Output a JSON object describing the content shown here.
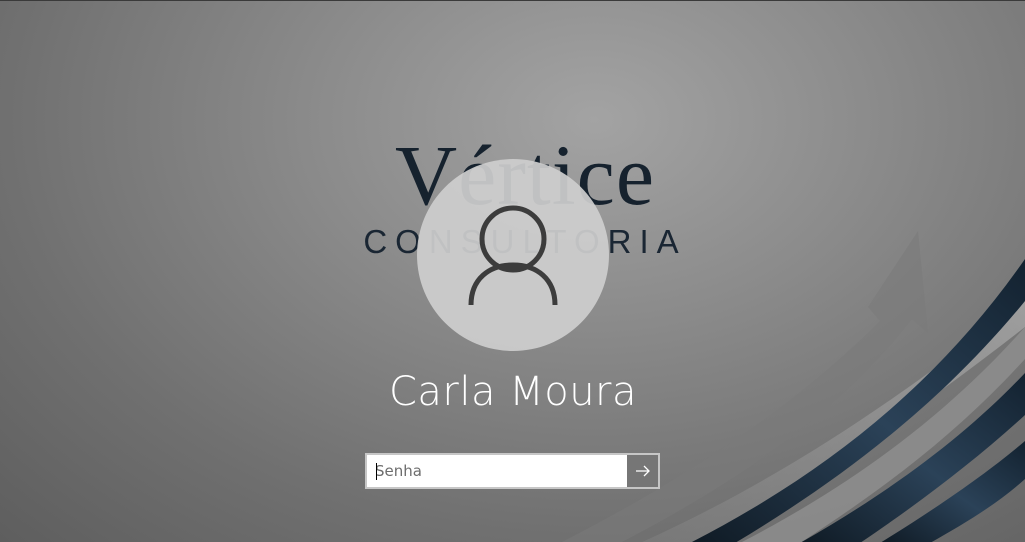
{
  "wallpaper": {
    "logo_word": "Vértice",
    "logo_sub": "CONSULTORIA",
    "accent_color": "#1f3245"
  },
  "login": {
    "avatar_icon": "user-icon",
    "user_name": "Carla Moura",
    "password_placeholder": "Senha",
    "password_value": "",
    "submit_icon": "arrow-right-icon"
  }
}
